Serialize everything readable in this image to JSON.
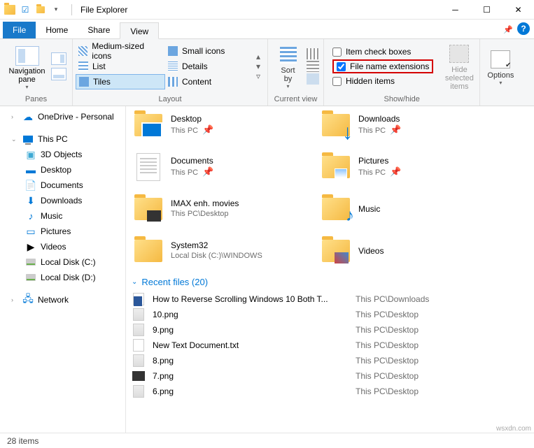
{
  "window": {
    "title": "File Explorer"
  },
  "tabs": {
    "file": "File",
    "home": "Home",
    "share": "Share",
    "view": "View"
  },
  "ribbon": {
    "panes_label": "Panes",
    "nav_pane": "Navigation\npane",
    "layout_label": "Layout",
    "layout": {
      "med": "Medium-sized icons",
      "small": "Small icons",
      "list": "List",
      "details": "Details",
      "tiles": "Tiles",
      "content": "Content"
    },
    "currentview_label": "Current view",
    "sort": "Sort\nby",
    "showhide_label": "Show/hide",
    "check_item": "Item check boxes",
    "check_ext": "File name extensions",
    "check_hidden": "Hidden items",
    "hide_selected": "Hide selected\nitems",
    "options": "Options"
  },
  "nav": {
    "onedrive": "OneDrive - Personal",
    "thispc": "This PC",
    "objs3d": "3D Objects",
    "desktop": "Desktop",
    "documents": "Documents",
    "downloads": "Downloads",
    "music": "Music",
    "pictures": "Pictures",
    "videos": "Videos",
    "diskc": "Local Disk (C:)",
    "diskd": "Local Disk (D:)",
    "network": "Network"
  },
  "tiles": [
    {
      "name": "Desktop",
      "sub": "This PC",
      "pinned": true,
      "kind": "folder-blue"
    },
    {
      "name": "Downloads",
      "sub": "This PC",
      "pinned": true,
      "kind": "folder-dl"
    },
    {
      "name": "Documents",
      "sub": "This PC",
      "pinned": true,
      "kind": "doc"
    },
    {
      "name": "Pictures",
      "sub": "This PC",
      "pinned": true,
      "kind": "folder-pic"
    },
    {
      "name": "IMAX enh. movies",
      "sub": "This PC\\Desktop",
      "pinned": false,
      "kind": "folder-vid"
    },
    {
      "name": "Music",
      "sub": "",
      "pinned": false,
      "kind": "folder-music"
    },
    {
      "name": "System32",
      "sub": "Local Disk (C:)\\WINDOWS",
      "pinned": false,
      "kind": "folder"
    },
    {
      "name": "Videos",
      "sub": "",
      "pinned": false,
      "kind": "folder-vid2"
    }
  ],
  "recent_header": "Recent files (20)",
  "recent": [
    {
      "name": "How to Reverse Scrolling Windows 10 Both T...",
      "loc": "This PC\\Downloads",
      "kind": "word"
    },
    {
      "name": "10.png",
      "loc": "This PC\\Desktop",
      "kind": "img"
    },
    {
      "name": "9.png",
      "loc": "This PC\\Desktop",
      "kind": "img"
    },
    {
      "name": "New Text Document.txt",
      "loc": "This PC\\Desktop",
      "kind": "txt"
    },
    {
      "name": "8.png",
      "loc": "This PC\\Desktop",
      "kind": "img"
    },
    {
      "name": "7.png",
      "loc": "This PC\\Desktop",
      "kind": "img2"
    },
    {
      "name": "6.png",
      "loc": "This PC\\Desktop",
      "kind": "img"
    }
  ],
  "status": "28 items"
}
